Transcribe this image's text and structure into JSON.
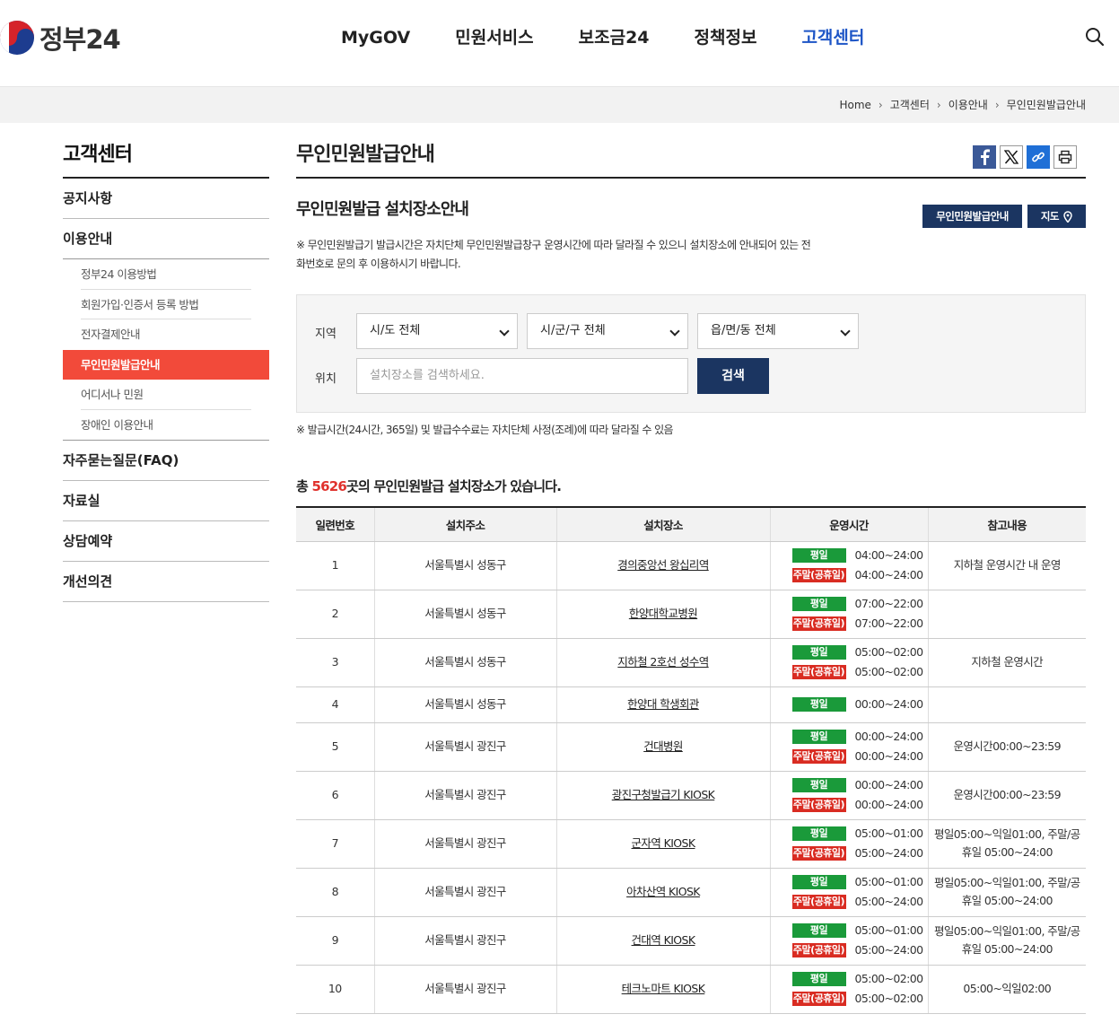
{
  "header": {
    "logo_text": "정부24",
    "nav": [
      "MyGOV",
      "민원서비스",
      "보조금24",
      "정책정보",
      "고객센터"
    ],
    "active_nav": "고객센터"
  },
  "breadcrumb": [
    "Home",
    "고객센터",
    "이용안내",
    "무인민원발급안내"
  ],
  "sidebar": {
    "title": "고객센터",
    "menu": [
      {
        "label": "공지사항"
      },
      {
        "label": "이용안내",
        "sub": [
          "정부24 이용방법",
          "회원가입·인증서 등록 방법",
          "전자결제안내",
          "무인민원발급안내",
          "어디서나 민원",
          "장애인 이용안내"
        ]
      },
      {
        "label": "자주묻는질문(FAQ)"
      },
      {
        "label": "자료실"
      },
      {
        "label": "상담예약"
      },
      {
        "label": "개선의견"
      }
    ]
  },
  "content": {
    "page_title": "무인민원발급안내",
    "sub_title": "무인민원발급 설치장소안내",
    "btn_guide": "무인민원발급안내",
    "btn_map": "지도",
    "note": "※ 무인민원발급기 발급시간은 자치단체 무인민원발급창구 운영시간에 따라 달라질 수 있으니 설치장소에 안내되어 있는 전화번호로 문의 후 이용하시기 바랍니다.",
    "search": {
      "region_label": "지역",
      "location_label": "위치",
      "sido": "시/도 전체",
      "sigungu": "시/군/구 전체",
      "eupmyeon": "읍/면/동 전체",
      "placeholder": "설치장소를 검색하세요.",
      "button": "검색"
    },
    "note2": "※ 발급시간(24시간, 365일) 및 발급수수료는 자치단체 사정(조례)에 따라 달라질 수 있음",
    "total_prefix": "총 ",
    "total_count": "5626",
    "total_suffix": "곳의 무인민원발급 설치장소가 있습니다."
  },
  "table": {
    "headers": [
      "일련번호",
      "설치주소",
      "설치장소",
      "운영시간",
      "참고내용"
    ],
    "weekday_label": "평일",
    "weekend_label": "주말(공휴일)",
    "rows": [
      {
        "no": "1",
        "addr": "서울특별시 성동구",
        "place": "경의중앙선 왕십리역",
        "weekday": "04:00~24:00",
        "weekend": "04:00~24:00",
        "note": "지하철 운영시간 내 운영"
      },
      {
        "no": "2",
        "addr": "서울특별시 성동구",
        "place": "한양대학교병원",
        "weekday": "07:00~22:00",
        "weekend": "07:00~22:00",
        "note": ""
      },
      {
        "no": "3",
        "addr": "서울특별시 성동구",
        "place": "지하철 2호선 성수역",
        "weekday": "05:00~02:00",
        "weekend": "05:00~02:00",
        "note": "지하철 운영시간"
      },
      {
        "no": "4",
        "addr": "서울특별시 성동구",
        "place": "한양대 학생회관",
        "weekday": "00:00~24:00",
        "weekend": "",
        "note": ""
      },
      {
        "no": "5",
        "addr": "서울특별시 광진구",
        "place": "건대병원",
        "weekday": "00:00~24:00",
        "weekend": "00:00~24:00",
        "note": "운영시간00:00~23:59"
      },
      {
        "no": "6",
        "addr": "서울특별시 광진구",
        "place": "광진구청발급기 KIOSK",
        "weekday": "00:00~24:00",
        "weekend": "00:00~24:00",
        "note": "운영시간00:00~23:59"
      },
      {
        "no": "7",
        "addr": "서울특별시 광진구",
        "place": "군자역 KIOSK",
        "weekday": "05:00~01:00",
        "weekend": "05:00~24:00",
        "note": "평일05:00~익일01:00, 주말/공휴일 05:00~24:00"
      },
      {
        "no": "8",
        "addr": "서울특별시 광진구",
        "place": "아차산역 KIOSK",
        "weekday": "05:00~01:00",
        "weekend": "05:00~24:00",
        "note": "평일05:00~익일01:00, 주말/공휴일 05:00~24:00"
      },
      {
        "no": "9",
        "addr": "서울특별시 광진구",
        "place": "건대역 KIOSK",
        "weekday": "05:00~01:00",
        "weekend": "05:00~24:00",
        "note": "평일05:00~익일01:00, 주말/공휴일 05:00~24:00"
      },
      {
        "no": "10",
        "addr": "서울특별시 광진구",
        "place": "테크노마트 KIOSK",
        "weekday": "05:00~02:00",
        "weekend": "05:00~02:00",
        "note": "05:00~익일02:00"
      }
    ]
  }
}
